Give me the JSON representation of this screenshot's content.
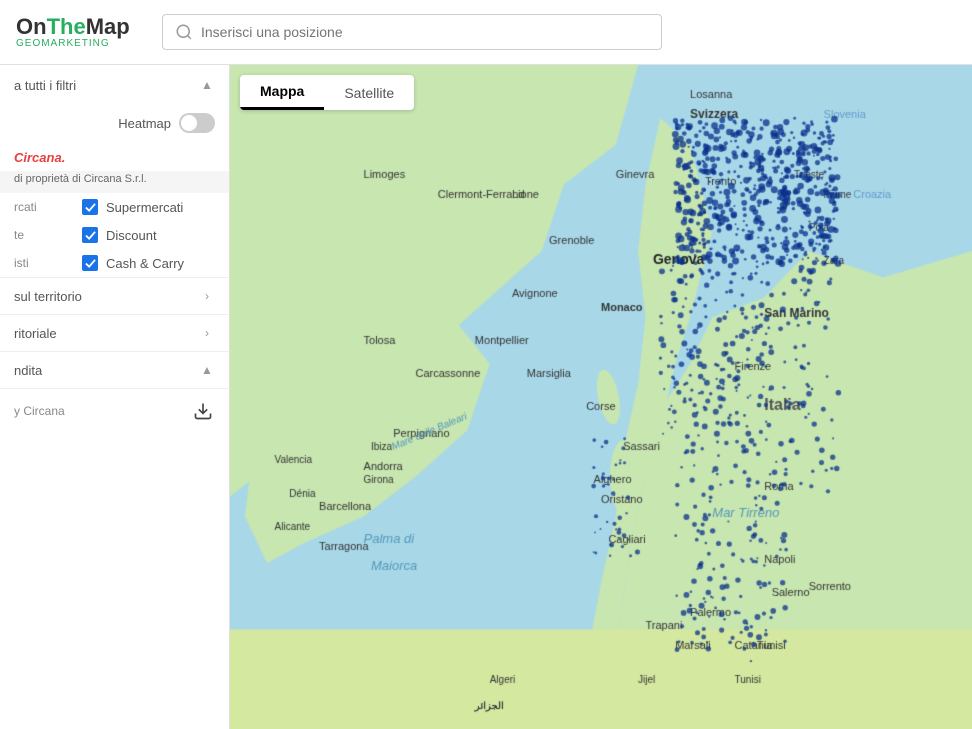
{
  "header": {
    "logo": {
      "part1": "On",
      "part2": "The",
      "part3": "Map",
      "subtitle": "Geomarketing"
    },
    "search": {
      "placeholder": "Inserisci una posizione"
    }
  },
  "sidebar": {
    "collapse_icon": "▲",
    "filter_label": "a tutti i filtri",
    "heatmap_label": "Heatmap",
    "heatmap_active": false,
    "circana_brand": "Circana.",
    "ownership": "di proprietà di Circana S.r.l.",
    "checkboxes": [
      {
        "left_label": "rcati",
        "label": "Supermercati",
        "checked": true
      },
      {
        "left_label": "te",
        "label": "Discount",
        "checked": true
      },
      {
        "left_label": "isti",
        "label": "Cash & Carry",
        "checked": true
      }
    ],
    "sections": [
      {
        "label": "sul territorio",
        "expanded": false
      },
      {
        "label": "ritoriale",
        "expanded": false
      },
      {
        "label": "ndita",
        "expanded": true
      }
    ],
    "download_label": "y Circana",
    "map_type": {
      "options": [
        "Mappa",
        "Satellite"
      ],
      "active": "Mappa"
    }
  }
}
